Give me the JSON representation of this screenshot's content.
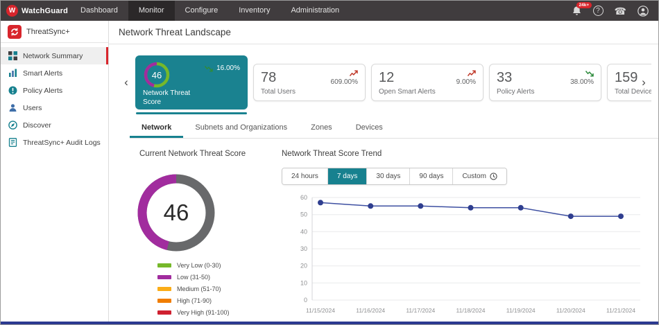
{
  "topbar": {
    "brand": "WatchGuard",
    "brand_initial": "W",
    "nav": [
      {
        "label": "Dashboard",
        "active": false
      },
      {
        "label": "Monitor",
        "active": true
      },
      {
        "label": "Configure",
        "active": false
      },
      {
        "label": "Inventory",
        "active": false
      },
      {
        "label": "Administration",
        "active": false
      }
    ],
    "notification_badge": "24k+"
  },
  "icons": {
    "prev": "‹",
    "next": "›",
    "help": "?",
    "phone": "☎"
  },
  "sidebar": {
    "product": "ThreatSync+",
    "items": [
      {
        "label": "Network Summary",
        "icon": "grid-icon",
        "active": true
      },
      {
        "label": "Smart Alerts",
        "icon": "bar-chart-icon",
        "active": false
      },
      {
        "label": "Policy Alerts",
        "icon": "exclamation-icon",
        "active": false
      },
      {
        "label": "Users",
        "icon": "person-icon",
        "active": false
      },
      {
        "label": "Discover",
        "icon": "compass-icon",
        "active": false
      },
      {
        "label": "ThreatSync+ Audit Logs",
        "icon": "document-icon",
        "active": false
      }
    ]
  },
  "page": {
    "title": "Network Threat Landscape"
  },
  "cards": [
    {
      "value": "46",
      "label": "Network Threat Score",
      "delta": "16.00%",
      "trend": "down",
      "selected": true
    },
    {
      "value": "78",
      "label": "Total Users",
      "delta": "609.00%",
      "trend": "up",
      "selected": false
    },
    {
      "value": "12",
      "label": "Open Smart Alerts",
      "delta": "9.00%",
      "trend": "up",
      "selected": false
    },
    {
      "value": "33",
      "label": "Policy Alerts",
      "delta": "38.00%",
      "trend": "down",
      "selected": false
    },
    {
      "value": "159",
      "label": "Total Devices",
      "delta": "",
      "trend": "",
      "selected": false
    }
  ],
  "tabs": [
    {
      "label": "Network",
      "active": true
    },
    {
      "label": "Subnets and Organizations",
      "active": false
    },
    {
      "label": "Zones",
      "active": false
    },
    {
      "label": "Devices",
      "active": false
    }
  ],
  "gauge": {
    "title": "Current Network Threat Score",
    "value": 46,
    "max": 100,
    "arc_color": "#A12C9E",
    "track_color": "#68696B",
    "legend": [
      {
        "label": "Very Low (0-30)",
        "color": "#76B82A"
      },
      {
        "label": "Low (31-50)",
        "color": "#A12C9E"
      },
      {
        "label": "Medium (51-70)",
        "color": "#FBAD18"
      },
      {
        "label": "High (71-90)",
        "color": "#F07D00"
      },
      {
        "label": "Very High (91-100)",
        "color": "#CF2030"
      }
    ]
  },
  "trend": {
    "title": "Network Threat Score Trend",
    "ranges": [
      {
        "label": "24 hours",
        "active": false
      },
      {
        "label": "7 days",
        "active": true
      },
      {
        "label": "30 days",
        "active": false
      },
      {
        "label": "90 days",
        "active": false
      },
      {
        "label": "Custom",
        "active": false
      }
    ]
  },
  "chart_data": {
    "type": "line",
    "title": "Network Threat Score Trend",
    "x": [
      "11/15/2024",
      "11/16/2024",
      "11/17/2024",
      "11/18/2024",
      "11/19/2024",
      "11/20/2024",
      "11/21/2024"
    ],
    "series": [
      {
        "name": "Network Threat Score",
        "values": [
          57,
          55,
          55,
          54,
          54,
          49,
          49
        ]
      }
    ],
    "ylim": [
      0,
      60
    ],
    "ytick_step": 10,
    "grid": true,
    "legend_position": "none",
    "line_color": "#3D4FA1",
    "point_color": "#2F3E8F"
  },
  "colors": {
    "accent_teal": "#17818F",
    "brand_red": "#D8252C",
    "selected_card_teal": "#1A8290"
  }
}
